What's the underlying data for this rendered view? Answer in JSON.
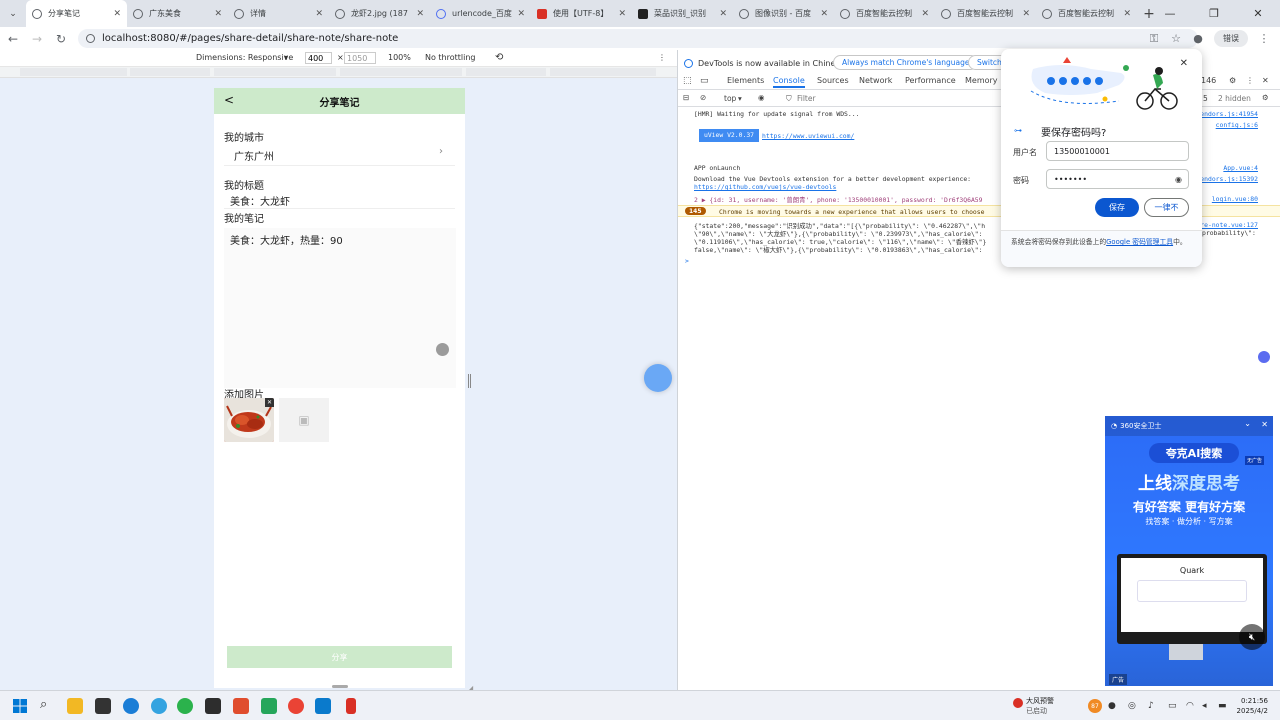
{
  "browser": {
    "tabs": [
      {
        "label": "分享笔记",
        "active": true,
        "icon": "globe-icon"
      },
      {
        "label": "广东美食",
        "active": false,
        "icon": "globe-icon"
      },
      {
        "label": "详情",
        "active": false,
        "icon": "globe-icon"
      },
      {
        "label": "龙虾2.jpg (187",
        "active": false,
        "icon": "globe-icon"
      },
      {
        "label": "urlencode_百度",
        "active": false,
        "icon": "baidu-icon"
      },
      {
        "label": "使用【UTF-8】",
        "active": false,
        "icon": "doc-icon"
      },
      {
        "label": "菜品识别_识别",
        "active": false,
        "icon": "ai-icon"
      },
      {
        "label": "图像识别 - 百度",
        "active": false,
        "icon": "globe-icon"
      },
      {
        "label": "百度智能云控制",
        "active": false,
        "icon": "globe-icon"
      },
      {
        "label": "百度智能云控制",
        "active": false,
        "icon": "globe-icon"
      },
      {
        "label": "百度智能云控制",
        "active": false,
        "icon": "globe-icon"
      }
    ],
    "url": "localhost:8080/#/pages/share-detail/share-note/share-note",
    "error_label": "错误"
  },
  "device_toolbar": {
    "dimensions": "Dimensions: Responsive",
    "width": "400",
    "times": "×",
    "height": "1050",
    "zoom": "100%",
    "throttle": "No throttling"
  },
  "app": {
    "nav_title": "分享笔记",
    "city_label": "我的城市",
    "city_value": "广东广州",
    "title_label": "我的标题",
    "title_value": "美食：大龙虾",
    "note_label": "我的笔记",
    "note_value": "美食：大龙虾，热量：90",
    "add_image_label": "添加图片",
    "share_button": "分享"
  },
  "devtools": {
    "banner_text": "DevTools is now available in Chinese!",
    "match_language": "Always match Chrome's language",
    "switch_label": "Switch",
    "tabs": [
      "Elements",
      "Console",
      "Sources",
      "Network",
      "Performance",
      "Memory"
    ],
    "active_tab": "Console",
    "context": "top",
    "filter_placeholder": "Filter",
    "issues_count": "146",
    "hidden_count": "2 hidden",
    "log_count": "5",
    "console": {
      "hmr": "[HMR] Waiting for update signal from WDS...",
      "hmr_src": "vendors.js:41954",
      "config_src": "config.js:6",
      "uview": "uView V2.0.37",
      "uview_link": "https://www.uviewui.com/",
      "launch": "APP onLaunch",
      "launch_src": "App.vue:4",
      "devtools_tip": "Download the Vue Devtools extension for a better development experience:",
      "devtools_link": "https://github.com/vuejs/vue-devtools",
      "devtools_src": "vendors.js:15392",
      "login_line": "2 ▶ {id: 31, username: '曾朗青', phone: '13500010001', password: 'Dr6f3Q6A59",
      "login_src": "login.vue:80",
      "warn_count": "145",
      "warn_text": "Chrome is moving towards a new experience that allows users to choose",
      "json_1": "{\"state\":200,\"message\":\"识别成功\",\"data\":\"[{\\\"probability\\\": \\\"0.462287\\\",\\\"h",
      "json_1_src": "share-note.vue:127",
      "json_2": "\\\"90\\\",\\\"name\\\": \\\"大龙虾\\\"},{\\\"probability\\\": \\\"0.239973\\\",\\\"has_calorie\\\":",
      "json_2_tail": "probability\\\":",
      "json_3": "\\\"0.119106\\\",\\\"has_calorie\\\": true,\\\"calorie\\\": \\\"116\\\",\\\"name\\\": \\\"香辣虾\\\"}",
      "json_4": "false,\\\"name\\\": \\\"椒大虾\\\"},{\\\"probability\\\": \\\"0.0193863\\\",\\\"has_calorie\\\":",
      "prompt": ">"
    }
  },
  "password_popup": {
    "title": "要保存密码吗?",
    "username_label": "用户名",
    "username_value": "13500010001",
    "password_label": "密码",
    "password_value": "•••••••",
    "save_button": "保存",
    "never_button": "一律不",
    "footer_text": "系统会将密码保存到此设备上的",
    "footer_link": "Google 密码管理工具",
    "footer_end": "中。"
  },
  "quark_ad": {
    "top_label": "360安全卫士",
    "pill": "夸克AI搜索",
    "corner": "无广告",
    "headline_pre": "上线",
    "headline_hl": "深度思考",
    "subline": "有好答案 更有好方案",
    "tags": "找答案 · 做分析 · 写方案",
    "brand": "Quark",
    "ad_tag": "广告"
  },
  "taskbar": {
    "news_title": "大风预警",
    "news_sub": "已启动",
    "badge": "87",
    "time": "0:21:56",
    "date": "2025/4/2"
  },
  "colors": {
    "app_green": "#cdeacb",
    "devtools_blue": "#1a73e8",
    "save_blue": "#0b57d0"
  }
}
